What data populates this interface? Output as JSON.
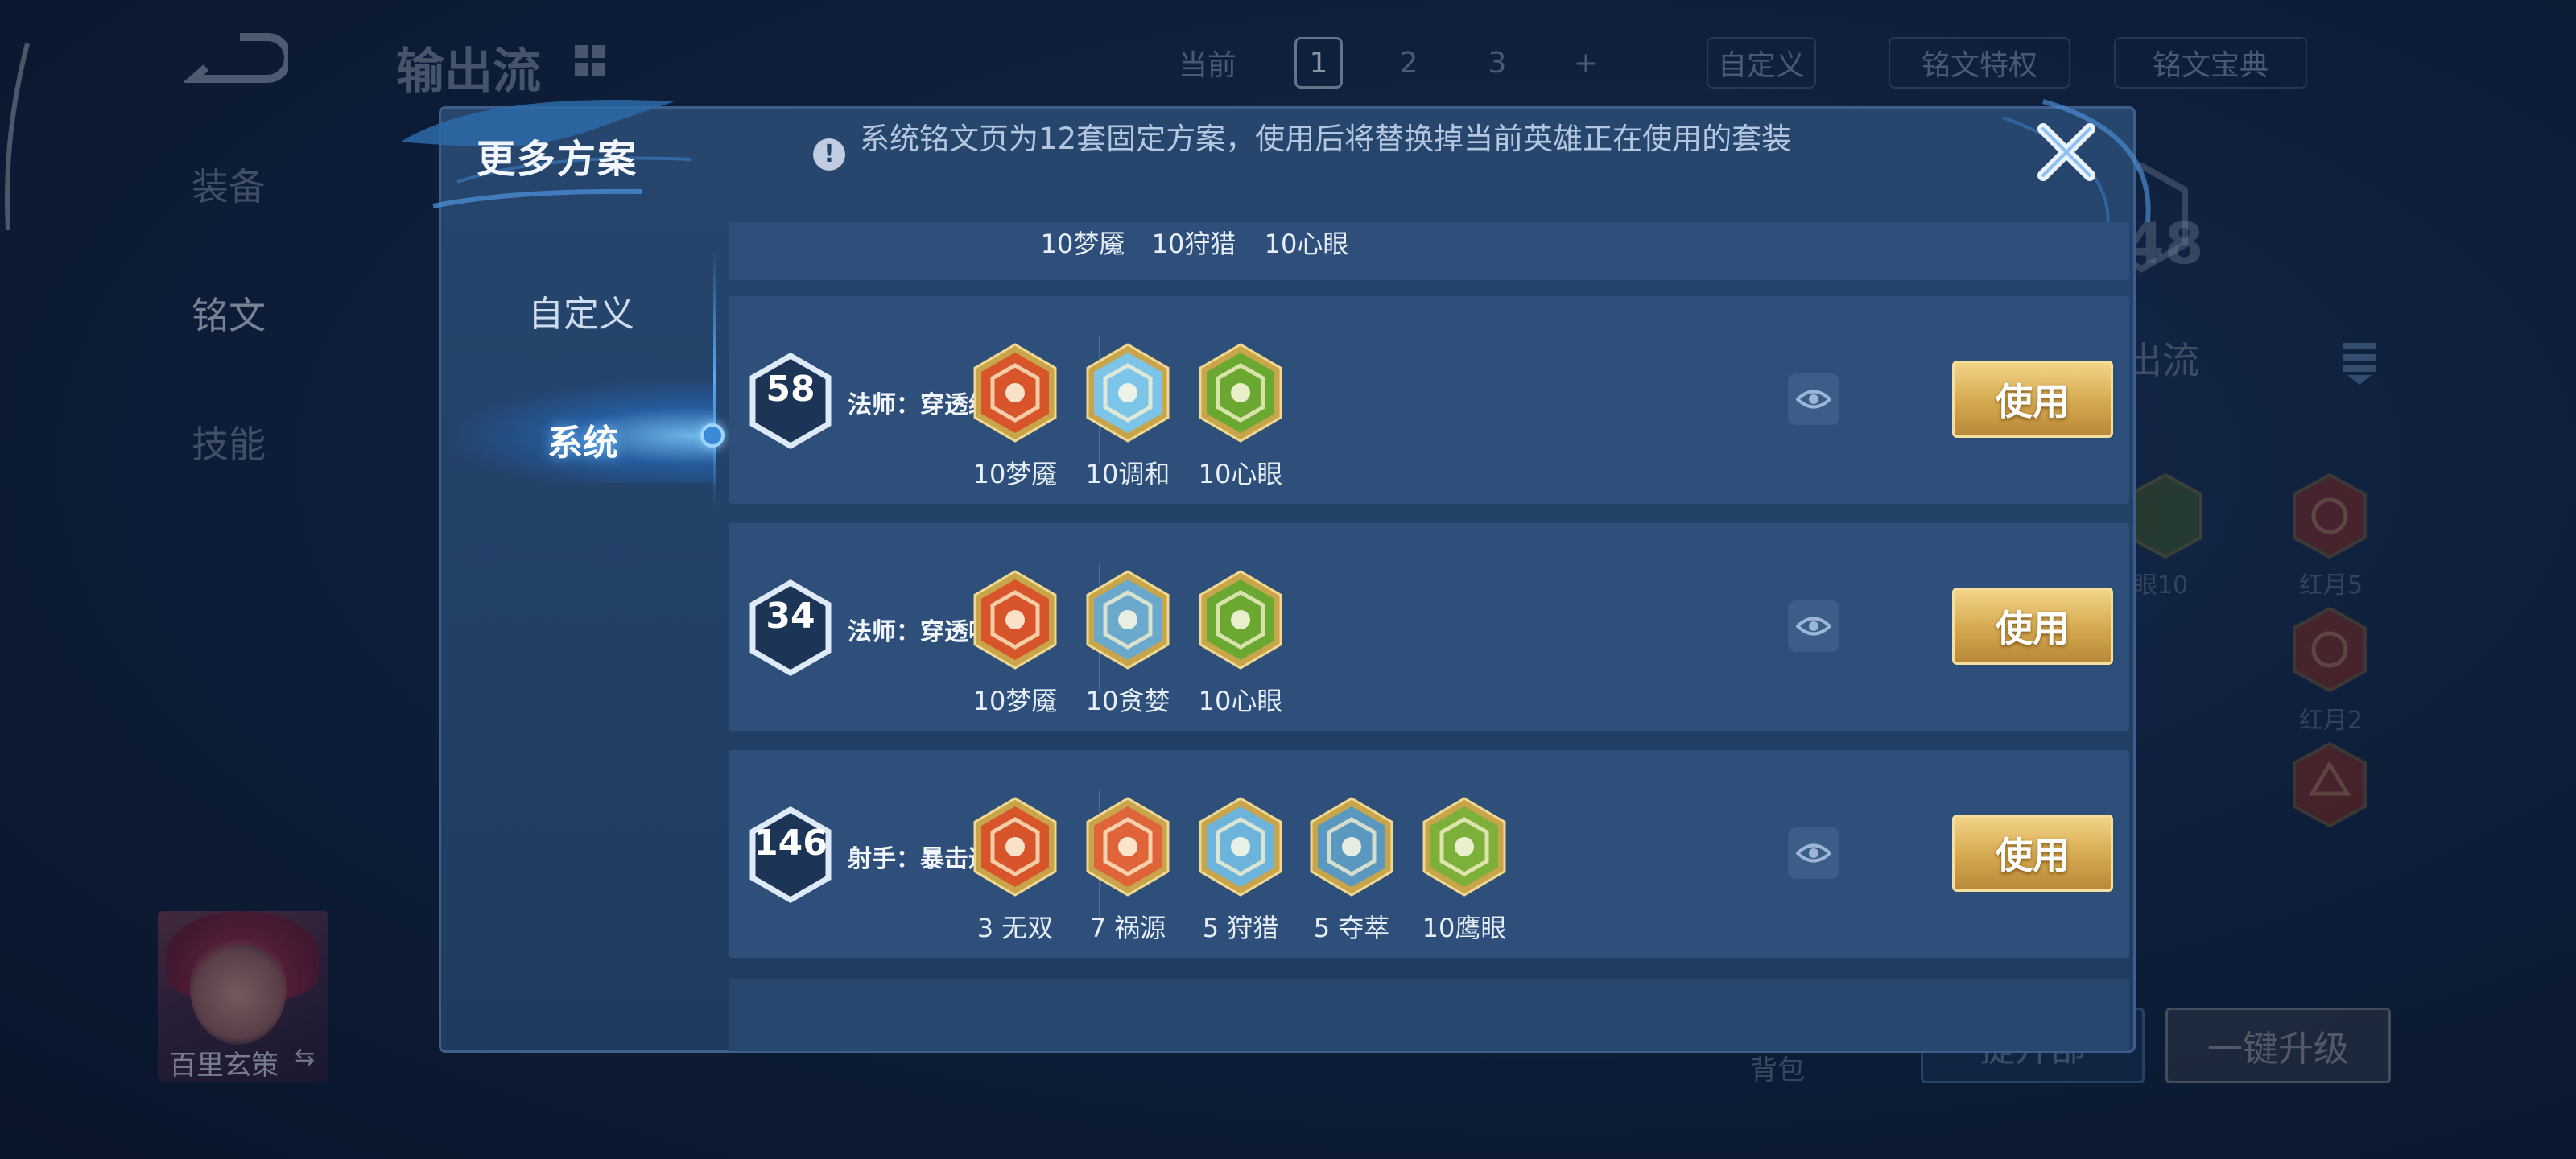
{
  "background": {
    "title": "输出流",
    "sidebar": [
      "装备",
      "铭文",
      "技能"
    ],
    "top_bar": {
      "current": "当前",
      "pages": [
        "1",
        "2",
        "3",
        "+"
      ],
      "custom": "自定义",
      "privilege": "铭文特权",
      "book": "铭文宝典"
    },
    "level": "48",
    "output_label": "出流",
    "rune_labels": [
      "眼10",
      "红月5",
      "红月2"
    ],
    "hero_name": "百里玄策",
    "hero_swap": "⇆",
    "bag": "背包",
    "upgrade_button": "一键升级",
    "left_button": "提升部"
  },
  "modal": {
    "title": "更多方案",
    "notice": "系统铭文页为12套固定方案，使用后将替换掉当前英雄正在使用的套装",
    "close_icon": "close-icon",
    "tabs": [
      "自定义",
      "系统"
    ],
    "partial_row_labels": [
      "10梦魇",
      "10狩猎",
      "10心眼"
    ],
    "plans": [
      {
        "level": "58",
        "name": "法师：穿透续航",
        "runes": [
          {
            "label": "10梦魇",
            "color": "#d8542a",
            "icon": "nightmare-rune-icon"
          },
          {
            "label": "10调和",
            "color": "#7cc4e8",
            "icon": "harmony-rune-icon"
          },
          {
            "label": "10心眼",
            "color": "#6aa832",
            "icon": "insight-rune-icon"
          }
        ],
        "use_label": "使用"
      },
      {
        "level": "34",
        "name": "法师：穿透吸血",
        "runes": [
          {
            "label": "10梦魇",
            "color": "#d8542a",
            "icon": "nightmare-rune-icon"
          },
          {
            "label": "10贪婪",
            "color": "#6aa8cc",
            "icon": "greed-rune-icon"
          },
          {
            "label": "10心眼",
            "color": "#6aa832",
            "icon": "insight-rune-icon"
          }
        ],
        "use_label": "使用"
      },
      {
        "level": "146",
        "name": "射手：暴击通用",
        "runes": [
          {
            "label": "3 无双",
            "color": "#d8542a",
            "icon": "peerless-rune-icon"
          },
          {
            "label": "7 祸源",
            "color": "#e0643a",
            "icon": "calamity-rune-icon"
          },
          {
            "label": "5 狩猎",
            "color": "#6cb4dc",
            "icon": "hunt-rune-icon"
          },
          {
            "label": "5 夺萃",
            "color": "#5a98c0",
            "icon": "seize-rune-icon"
          },
          {
            "label": "10鹰眼",
            "color": "#7cb03a",
            "icon": "hawkeye-rune-icon"
          }
        ],
        "use_label": "使用"
      }
    ],
    "colors": {
      "accent": "#6ab8ff",
      "gold": "#d4a84e",
      "panel": "#2d4f7a"
    }
  }
}
